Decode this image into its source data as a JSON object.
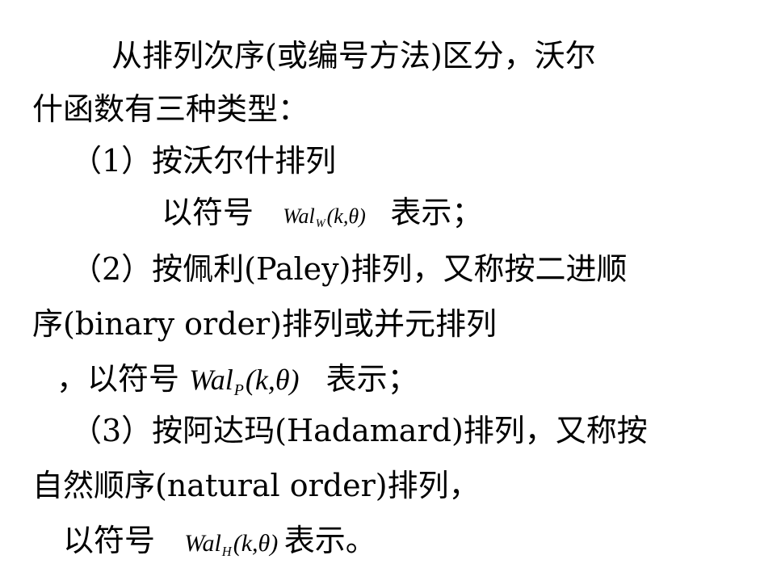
{
  "lines": {
    "l1": "从排列次序(或编号方法)区分，沃尔",
    "l2": "什函数有三种类型：",
    "l3": "（1）按沃尔什排列",
    "l4_prefix": "以符号",
    "l4_suffix": "表示；",
    "l5": "（2）按佩利(Paley)排列，又称按二进顺",
    "l6": "序(binary order)排列或并元排列",
    "l7_prefix": "，以符号",
    "l7_suffix": "表示；",
    "l8": "（3）按阿达玛(Hadamard)排列，又称按",
    "l9": "自然顺序(natural order)排列，",
    "l10_prefix": "以符号",
    "l10_suffix": "表示。"
  },
  "formulas": {
    "walsh": {
      "base": "Wal",
      "sub": "W",
      "args": "(k,θ)"
    },
    "paley": {
      "base": "Wal",
      "sub": "P",
      "args": "(k,θ)"
    },
    "hadamard": {
      "base": "Wal",
      "sub": "H",
      "args": "(k,θ)"
    }
  }
}
